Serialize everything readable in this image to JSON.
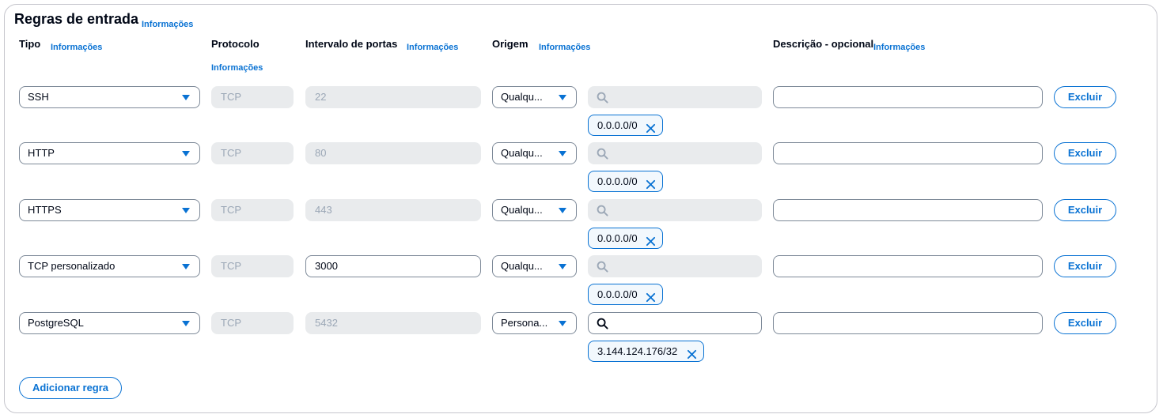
{
  "section": {
    "title": "Regras de entrada",
    "info": "Informações"
  },
  "headers": {
    "tipo": "Tipo",
    "tipo_info": "Informações",
    "protocolo": "Protocolo",
    "protocolo_info": "Informações",
    "intervalo": "Intervalo de portas",
    "intervalo_info": "Informações",
    "origem": "Origem",
    "origem_info": "Informações",
    "descricao": "Descrição - opcional",
    "descricao_info": "Informações"
  },
  "rules": [
    {
      "tipo": "SSH",
      "protocolo": "TCP",
      "porta": "22",
      "porta_editable": false,
      "origem": "Qualqu...",
      "search_enabled": false,
      "cidr": "0.0.0.0/0",
      "descricao": "",
      "delete_label": "Excluir"
    },
    {
      "tipo": "HTTP",
      "protocolo": "TCP",
      "porta": "80",
      "porta_editable": false,
      "origem": "Qualqu...",
      "search_enabled": false,
      "cidr": "0.0.0.0/0",
      "descricao": "",
      "delete_label": "Excluir"
    },
    {
      "tipo": "HTTPS",
      "protocolo": "TCP",
      "porta": "443",
      "porta_editable": false,
      "origem": "Qualqu...",
      "search_enabled": false,
      "cidr": "0.0.0.0/0",
      "descricao": "",
      "delete_label": "Excluir"
    },
    {
      "tipo": "TCP personalizado",
      "protocolo": "TCP",
      "porta": "3000",
      "porta_editable": true,
      "origem": "Qualqu...",
      "search_enabled": false,
      "cidr": "0.0.0.0/0",
      "descricao": "",
      "delete_label": "Excluir"
    },
    {
      "tipo": "PostgreSQL",
      "protocolo": "TCP",
      "porta": "5432",
      "porta_editable": false,
      "origem": "Persona...",
      "search_enabled": true,
      "cidr": "3.144.124.176/32",
      "descricao": "",
      "delete_label": "Excluir"
    }
  ],
  "add_rule_label": "Adicionar regra",
  "icons": {
    "dropdown": "caret-down-icon",
    "search": "search-icon",
    "remove": "close-icon"
  },
  "colors": {
    "accent": "#0972d3",
    "disabled_bg": "#e9ebed",
    "border": "#7d8998"
  }
}
